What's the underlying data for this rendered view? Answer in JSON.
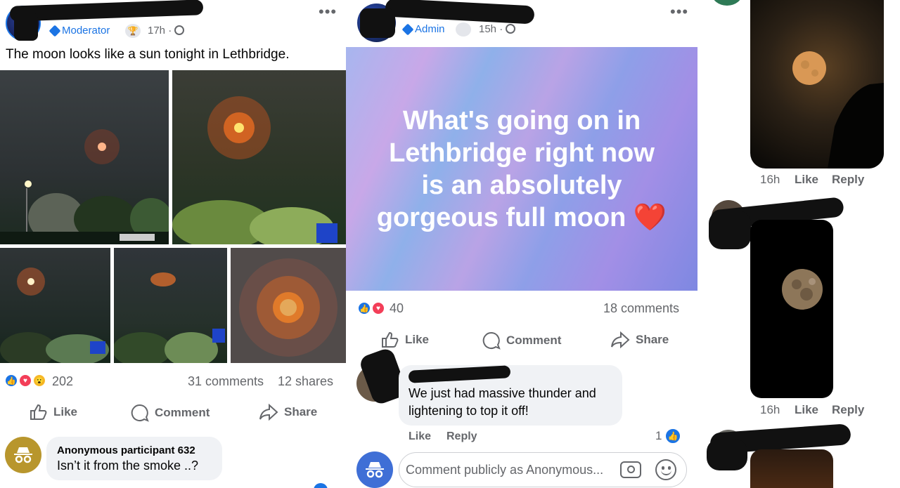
{
  "post1": {
    "role_badge": "Moderator",
    "time": "17h ·",
    "text": "The moon looks like a sun tonight in Lethbridge.",
    "reaction_count": "202",
    "comments": "31 comments",
    "shares": "12 shares",
    "actions": {
      "like": "Like",
      "comment": "Comment",
      "share": "Share"
    },
    "comment": {
      "author": "Anonymous participant 632",
      "text": "Isn’t it from the smoke ..?"
    }
  },
  "post2": {
    "role_badge": "Admin",
    "time": "15h ·",
    "background_text": "What's going on in Lethbridge right now is an absolutely gorgeous full moon ❤️",
    "reaction_count": "40",
    "comments": "18 comments",
    "actions": {
      "like": "Like",
      "comment": "Comment",
      "share": "Share"
    },
    "comment": {
      "text": "We just had massive thunder and lightening to top it off!",
      "like": "Like",
      "reply": "Reply",
      "like_count": "1"
    },
    "composer_placeholder": "Comment publicly as Anonymous..."
  },
  "right_column": {
    "comment1": {
      "time": "16h",
      "like": "Like",
      "reply": "Reply"
    },
    "comment2": {
      "time": "16h",
      "like": "Like",
      "reply": "Reply"
    }
  },
  "colors": {
    "accent": "#1b74e4",
    "link": "#65676b",
    "bubble": "#f0f2f5"
  }
}
